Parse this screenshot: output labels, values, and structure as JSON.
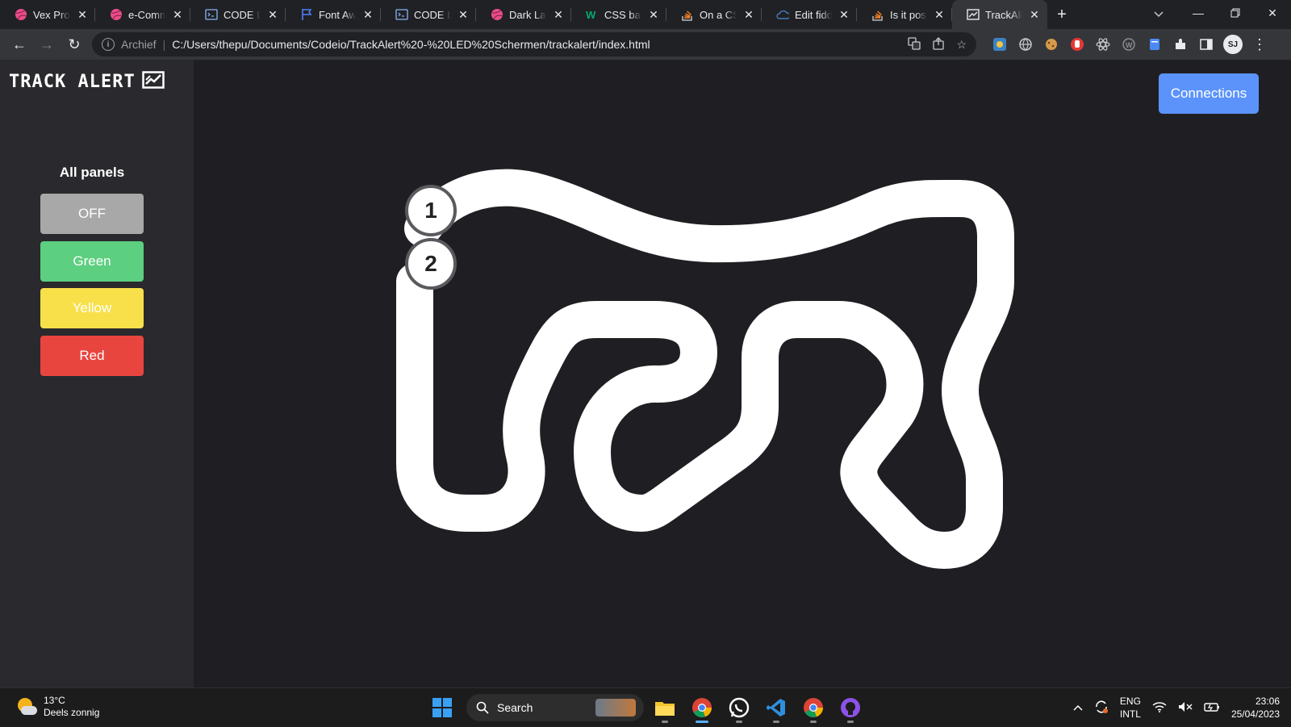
{
  "browser": {
    "tabs": [
      {
        "title": "Vex Products",
        "icon": "dribbble-icon",
        "color": "#ea4c89"
      },
      {
        "title": "e-Commerce",
        "icon": "dribbble-icon",
        "color": "#ea4c89"
      },
      {
        "title": "CODE I/O",
        "icon": "code-io-icon",
        "color": "#8ab4f8"
      },
      {
        "title": "Font Awesome",
        "icon": "flag-icon",
        "color": "#4f7ef8"
      },
      {
        "title": "CODE I/O",
        "icon": "code-io-icon",
        "color": "#8ab4f8"
      },
      {
        "title": "Dark Landing",
        "icon": "dribbble-icon",
        "color": "#ea4c89"
      },
      {
        "title": "CSS background",
        "icon": "w3schools-icon",
        "color": "#04aa6d"
      },
      {
        "title": "On a CSS",
        "icon": "stackoverflow-icon",
        "color": "#f48024"
      },
      {
        "title": "Edit fiddle",
        "icon": "jsfiddle-icon",
        "color": "#4679bd"
      },
      {
        "title": "Is it possible",
        "icon": "stackoverflow-icon",
        "color": "#f48024"
      },
      {
        "title": "TrackAlert",
        "icon": "trackalert-icon",
        "color": "#e8eaed",
        "active": true
      }
    ],
    "new_tab_label": "+",
    "tab_close_glyph": "✕",
    "address": {
      "protocol_label": "Archief",
      "url": "C:/Users/thepu/Documents/Codeio/TrackAlert%20-%20LED%20Schermen/trackalert/index.html"
    },
    "profile_initials": "SJ"
  },
  "app": {
    "logo_text": "TRACK ALERT",
    "panels_title": "All panels",
    "buttons": {
      "off": "OFF",
      "green": "Green",
      "yellow": "Yellow",
      "red": "Red"
    },
    "connections_label": "Connections",
    "markers": [
      "1",
      "2"
    ],
    "colors": {
      "off": "#a8a8a8",
      "green": "#5dcf80",
      "yellow": "#f8e04a",
      "red": "#e9453f",
      "connections": "#5b93fb",
      "track": "#ffffff",
      "background": "#1f1f23",
      "sidebar": "#2a2a2e"
    }
  },
  "taskbar": {
    "weather_temp": "13°C",
    "weather_desc": "Deels zonnig",
    "search_placeholder": "Search",
    "lang_primary": "ENG",
    "lang_secondary": "INTL",
    "time": "23:06",
    "date": "25/04/2023"
  }
}
